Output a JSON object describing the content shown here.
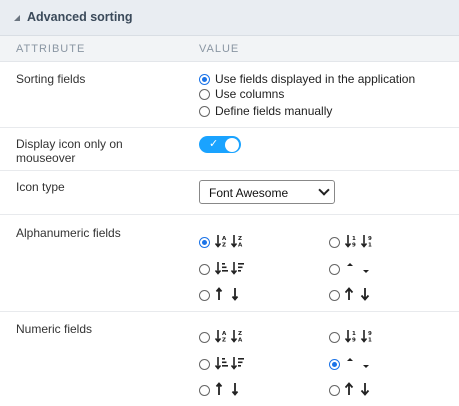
{
  "section": {
    "title": "Advanced sorting"
  },
  "columns": {
    "attribute": "ATTRIBUTE",
    "value": "VALUE"
  },
  "sorting_fields": {
    "label": "Sorting fields",
    "options": [
      {
        "label": "Use fields displayed in the application",
        "selected": true
      },
      {
        "label": "Use columns",
        "selected": false
      },
      {
        "label": "Define fields manually",
        "selected": false
      }
    ]
  },
  "display_icon": {
    "label_line1": "Display icon only on",
    "label_line2": "mouseover",
    "enabled": true,
    "check": "✓"
  },
  "icon_type": {
    "label": "Icon type",
    "value": "Font Awesome"
  },
  "alphanumeric": {
    "label": "Alphanumeric fields",
    "selected_index": 0,
    "options": [
      "sort-alpha-icon",
      "sort-amount-alpha-icon",
      "sort-numeric-icon",
      "caret-icon",
      "arrow-thin-icon",
      "arrow-bold-icon"
    ]
  },
  "numeric": {
    "label": "Numeric fields",
    "selected_index": 3,
    "options": [
      "sort-alpha-icon",
      "sort-amount-alpha-icon",
      "sort-numeric-icon",
      "caret-icon",
      "arrow-thin-icon",
      "arrow-bold-icon"
    ]
  },
  "colors": {
    "accent": "#1a73e8",
    "toggle": "#1aa3ff",
    "header_bg": "#e9edf2"
  }
}
